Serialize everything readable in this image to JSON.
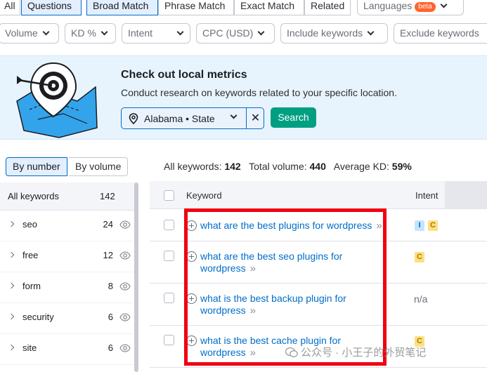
{
  "tabs": {
    "all": "All",
    "questions": "Questions",
    "broad_match": "Broad Match",
    "phrase_match": "Phrase Match",
    "exact_match": "Exact Match",
    "related": "Related",
    "languages": "Languages",
    "languages_badge": "beta"
  },
  "filters": {
    "volume": "Volume",
    "kd": "KD %",
    "intent": "Intent",
    "cpc": "CPC (USD)",
    "include": "Include keywords",
    "exclude": "Exclude keywords"
  },
  "banner": {
    "title": "Check out local metrics",
    "subtitle": "Conduct research on keywords related to your specific location.",
    "location_value": "Alabama • State",
    "search_label": "Search"
  },
  "left_panel": {
    "by_number": "By number",
    "by_volume": "By volume",
    "all_keywords_label": "All keywords",
    "all_keywords_count": "142",
    "groups": [
      {
        "label": "seo",
        "count": "24"
      },
      {
        "label": "free",
        "count": "12"
      },
      {
        "label": "form",
        "count": "8"
      },
      {
        "label": "security",
        "count": "6"
      },
      {
        "label": "site",
        "count": "6"
      }
    ]
  },
  "summary": {
    "all_keywords_label": "All keywords:",
    "all_keywords_value": "142",
    "total_volume_label": "Total volume:",
    "total_volume_value": "440",
    "avg_kd_label": "Average KD:",
    "avg_kd_value": "59%"
  },
  "table": {
    "col_keyword": "Keyword",
    "col_intent": "Intent",
    "rows": [
      {
        "keyword": "what are the best plugins for wordpress",
        "intent": [
          "I",
          "C"
        ]
      },
      {
        "keyword_line1": "what are the best seo plugins for",
        "keyword_line2": "wordpress",
        "intent": [
          "C"
        ]
      },
      {
        "keyword_line1": "what is the best backup plugin for",
        "keyword_line2": "wordpress",
        "intent_text": "n/a"
      },
      {
        "keyword_line1": "what is the best cache plugin for",
        "keyword_line2": "wordpress",
        "intent": [
          "C"
        ]
      }
    ]
  },
  "watermark": "公众号 · 小王子的外贸笔记",
  "colors": {
    "accent_blue": "#006dca",
    "search_green": "#009f81",
    "annotation_red": "#f00010",
    "banner_bg": "#e8f4fd"
  }
}
